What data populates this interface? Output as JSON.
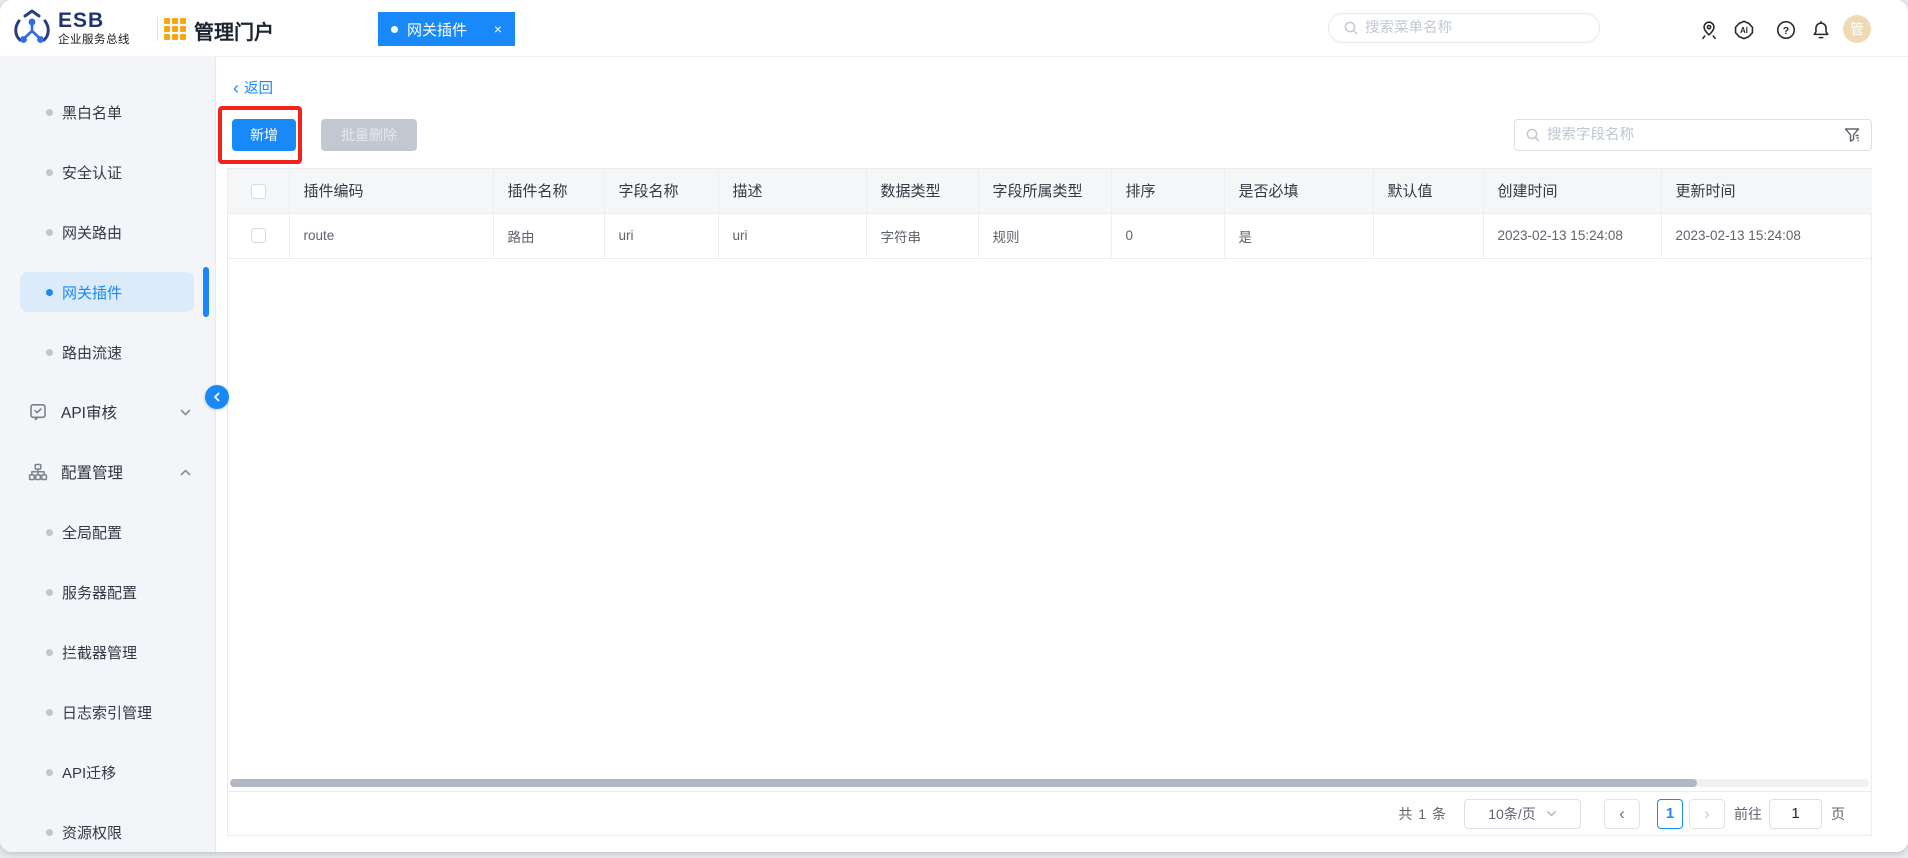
{
  "header": {
    "logo_title": "ESB",
    "logo_subtitle": "企业服务总线",
    "portal_title": "管理门户",
    "tab_label": "网关插件",
    "tab_close": "×",
    "menu_search_placeholder": "搜索菜单名称",
    "ai_badge_text": "AI",
    "help_glyph": "?",
    "avatar_text": "管"
  },
  "sidebar": {
    "items": [
      {
        "label": "黑白名单",
        "active": false
      },
      {
        "label": "安全认证",
        "active": false
      },
      {
        "label": "网关路由",
        "active": false
      },
      {
        "label": "网关插件",
        "active": true
      },
      {
        "label": "路由流速",
        "active": false
      },
      {
        "label": "API审核",
        "group": true,
        "chevron": "down"
      },
      {
        "label": "配置管理",
        "group": true,
        "chevron": "up"
      },
      {
        "label": "全局配置",
        "active": false
      },
      {
        "label": "服务器配置",
        "active": false
      },
      {
        "label": "拦截器管理",
        "active": false
      },
      {
        "label": "日志索引管理",
        "active": false
      },
      {
        "label": "API迁移",
        "active": false
      },
      {
        "label": "资源权限",
        "active": false
      }
    ]
  },
  "main": {
    "back_chevron": "‹",
    "back_label": "返回",
    "add_button_label": "新增",
    "batch_delete_label": "批量删除",
    "field_search_placeholder": "搜索字段名称",
    "table": {
      "columns": [
        "插件编码",
        "插件名称",
        "字段名称",
        "描述",
        "数据类型",
        "字段所属类型",
        "排序",
        "是否必填",
        "默认值",
        "创建时间",
        "更新时间"
      ],
      "rows": [
        {
          "plugin_code": "route",
          "plugin_name": "路由",
          "field_name": "uri",
          "description": "uri",
          "data_type": "字符串",
          "field_owner_type": "规则",
          "sort": "0",
          "required": "是",
          "default_value": "",
          "created_at": "2023-02-13 15:24:08",
          "updated_at": "2023-02-13 15:24:08"
        }
      ]
    },
    "pagination": {
      "total_text": "共 1 条",
      "page_size_text": "10条/页",
      "prev_glyph": "‹",
      "current_page": "1",
      "next_glyph": "›",
      "goto_label": "前往",
      "goto_value": "1",
      "unit_label": "页"
    }
  },
  "colors": {
    "primary_blue": "#1989fa",
    "annotation_red": "#f3231b",
    "sidebar_active_bg": "#dcebfa",
    "table_header_bg": "#f5f6f8",
    "avatar_bg": "#f0dab4",
    "disabled_button_bg": "#c2c8d2"
  }
}
